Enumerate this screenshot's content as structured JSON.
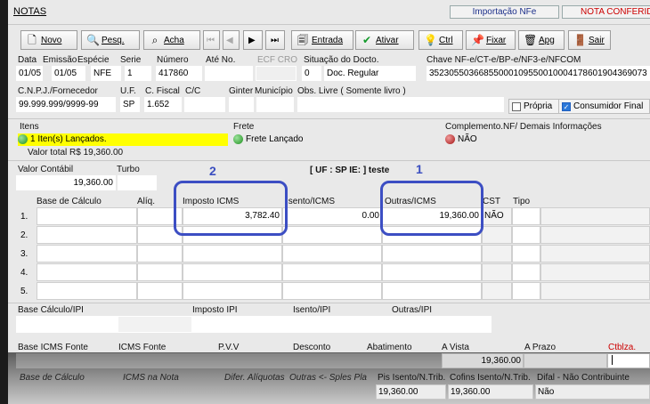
{
  "title": "NOTAS",
  "header_tabs": {
    "importacao": "Importação NFe",
    "nota_conferida": "NOTA CONFERIDA"
  },
  "toolbar": {
    "novo": "Novo",
    "pesq": "Pesq.",
    "acha": "Acha",
    "entrada": "Entrada",
    "ativar": "Ativar",
    "ctrl": "Ctrl",
    "fixar": "Fixar",
    "apg": "Apg",
    "sair": "Sair"
  },
  "header_fields": {
    "labels": {
      "data": "Data",
      "emissao": "Emissão",
      "especie": "Espécie",
      "serie": "Serie",
      "numero": "Número",
      "ate_no": "Até No.",
      "ecf_cro": "ECF CRO",
      "situacao": "Situação do Docto.",
      "chave": "Chave NF-e/CT-e/BP-e/NF3-e/NFCOM"
    },
    "values": {
      "data": "01/05",
      "emissao": "01/05",
      "especie": "NFE",
      "serie": "1",
      "numero": "417860",
      "situacao_code": "0",
      "situacao": "Doc. Regular",
      "chave": "35230550366855000109550010004178601904369073"
    }
  },
  "fornecedor": {
    "labels": {
      "cnpj": "C.N.P.J./Fornecedor",
      "uf": "U.F.",
      "cfiscal": "C. Fiscal",
      "cc": "C/C",
      "ginter": "Ginter",
      "municipio": "Município",
      "obs": "Obs. Livre ( Somente livro )"
    },
    "values": {
      "cnpj": "99.999.999/9999-99",
      "uf": "SP",
      "cfiscal": "1.652"
    },
    "propria": "Própria",
    "consumidor_final": "Consumidor Final"
  },
  "itens": {
    "label": "Itens",
    "status": "1 Iten(s) Lançados.",
    "total": "Valor total R$ 19,360.00"
  },
  "frete": {
    "label": "Frete",
    "status": "Frete Lançado"
  },
  "complemento": {
    "label": "Complemento.NF/ Demais Informações",
    "status": "NÃO"
  },
  "valor_contabil": {
    "label": "Valor Contábil",
    "value": "19,360.00"
  },
  "turbo": {
    "label": "Turbo"
  },
  "uf_info": "[ UF : SP IE: ] teste",
  "icms_grid": {
    "headers": {
      "base": "Base de Cálculo",
      "aliq": "Alíq.",
      "imposto": "Imposto ICMS",
      "isento": "Isento/ICMS",
      "outras": "Outras/ICMS",
      "cst": "CST",
      "tipo": "Tipo"
    },
    "rows": [
      {
        "n": "1.",
        "imposto": "3,782.40",
        "isento": "0.00",
        "outras": "19,360.00",
        "cst": "NÃO"
      },
      {
        "n": "2."
      },
      {
        "n": "3."
      },
      {
        "n": "4."
      },
      {
        "n": "5."
      }
    ]
  },
  "annotations": {
    "one": "1",
    "two": "2"
  },
  "ipi": {
    "base": "Base Cálculo/IPI",
    "imposto": "Imposto IPI",
    "isento": "Isento/IPI",
    "outras": "Outras/IPI"
  },
  "fonte": {
    "base": "Base ICMS Fonte",
    "icms": "ICMS Fonte",
    "pvv": "P.V.V",
    "desconto": "Desconto",
    "abatimento": "Abatimento",
    "a_vista": "A Vista",
    "a_prazo": "A Prazo",
    "ctblza": "Ctblza.",
    "a_vista_value": "19,360.00"
  },
  "footer": {
    "base": "Base de Cálculo",
    "icms_nota": "ICMS na Nota",
    "difer": "Difer. Alíquotas",
    "outras": "Outras <- Sples Pla",
    "pis_label": "Pis Isento/N.Trib.",
    "pis_value": "19,360.00",
    "cofins_label": "Cofins Isento/N.Trib.",
    "cofins_value": "19,360.00",
    "difal_label": "Difal - Não Contribuinte",
    "difal_value": "Não"
  },
  "colors": {
    "accent_blue": "#3c4ec3",
    "highlight_yellow": "#ffff00",
    "red_label": "#cc0000"
  }
}
